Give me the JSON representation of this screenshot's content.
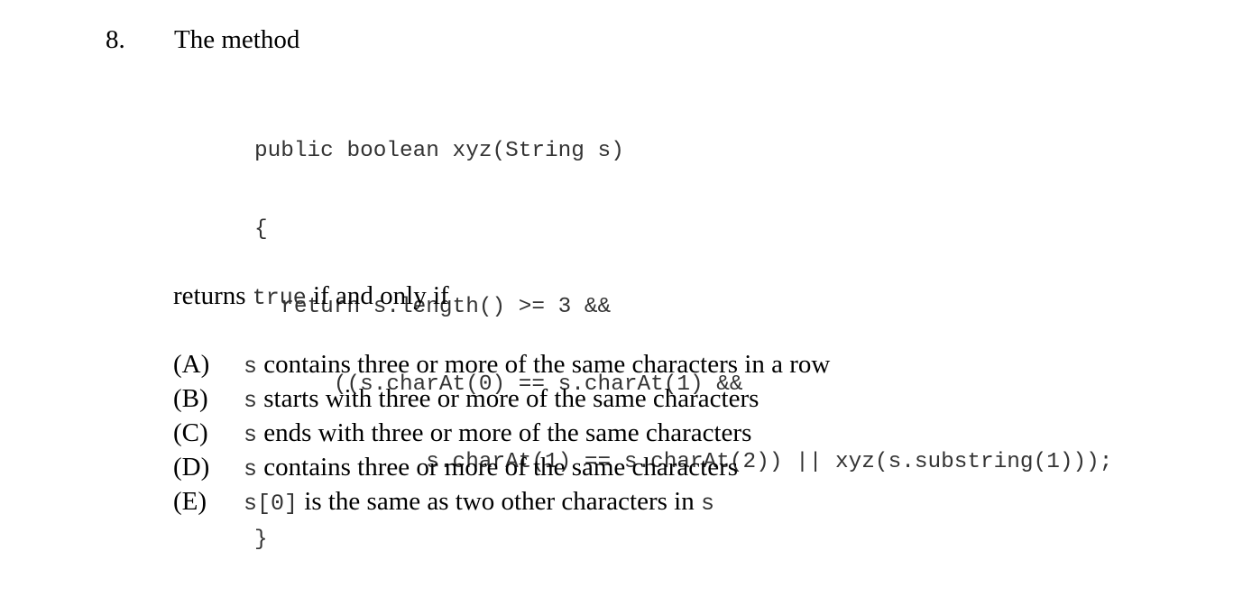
{
  "question": {
    "number": "8.",
    "intro": "The method"
  },
  "code_lines": [
    "public boolean xyz(String s)",
    "{",
    "  return s.length() >= 3 &&",
    "      ((s.charAt(0) == s.charAt(1) &&",
    "             s.charAt(1) == s.charAt(2)) || xyz(s.substring(1)));",
    "}"
  ],
  "stem": {
    "prefix": "returns ",
    "code": "true",
    "suffix": " if and only if"
  },
  "choices": [
    {
      "letter": "(A)",
      "code": "s",
      "text": " contains three or more of the same characters in a row",
      "code2": ""
    },
    {
      "letter": "(B)",
      "code": "s",
      "text": " starts with three or more of the same characters",
      "code2": ""
    },
    {
      "letter": "(C)",
      "code": "s",
      "text": " ends with three or more of the same characters",
      "code2": ""
    },
    {
      "letter": "(D)",
      "code": "s",
      "text": " contains three or more of the same characters",
      "code2": ""
    },
    {
      "letter": "(E)",
      "code": "s[0]",
      "text": " is the same as two other characters in ",
      "code2": "s"
    }
  ]
}
